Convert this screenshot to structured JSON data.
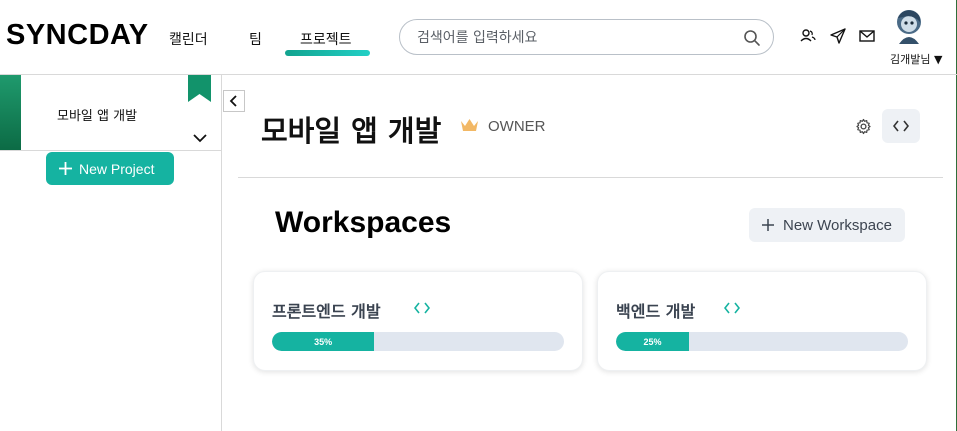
{
  "header": {
    "logo": "SYNCDAY",
    "nav": [
      {
        "label": "캘린더"
      },
      {
        "label": "팀"
      },
      {
        "label": "프로젝트",
        "active": true
      }
    ],
    "search_placeholder": "검색어를 입력하세요",
    "icons": [
      "people-icon",
      "send-icon",
      "mail-icon"
    ],
    "user_name": "김개발님 ▼"
  },
  "sidebar": {
    "projects": [
      {
        "label": "모바일 앱 개발",
        "selected": true
      }
    ],
    "new_project_label": "New Project"
  },
  "main": {
    "project_title": "모바일 앱 개발",
    "role": "OWNER",
    "workspaces_title": "Workspaces",
    "new_workspace_label": "New Workspace",
    "workspaces": [
      {
        "name": "프론트엔드 개발",
        "progress": 35,
        "progress_label": "35%"
      },
      {
        "name": "백엔드 개발",
        "progress": 25,
        "progress_label": "25%"
      }
    ]
  },
  "colors": {
    "accent": "#15b3a1",
    "progress_track": "#e0e6ef",
    "sidebar_accent": "#0c6b45"
  }
}
